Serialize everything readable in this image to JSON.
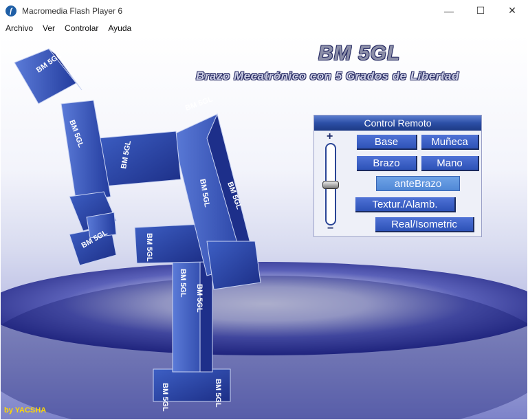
{
  "window": {
    "title": "Macromedia Flash Player 6"
  },
  "menu": [
    "Archivo",
    "Ver",
    "Controlar",
    "Ayuda"
  ],
  "app": {
    "title": "BM 5GL",
    "subtitle": "Brazo Mecatrónico con 5 Grados de Libertad",
    "credit": "by YACSHA",
    "cube_label": "BM 5GL"
  },
  "control": {
    "title": "Control Remoto",
    "slider_plus": "+",
    "slider_minus": "−",
    "slider_level": 0.48,
    "buttons": {
      "base": "Base",
      "muneca": "Muñeca",
      "brazo": "Brazo",
      "mano": "Mano",
      "antebrazo": "anteBrazo",
      "textura": "Textur./Alamb.",
      "real": "Real/Isometric"
    }
  },
  "colors": {
    "accent": "#2d52b7",
    "credit": "#ffd800"
  }
}
